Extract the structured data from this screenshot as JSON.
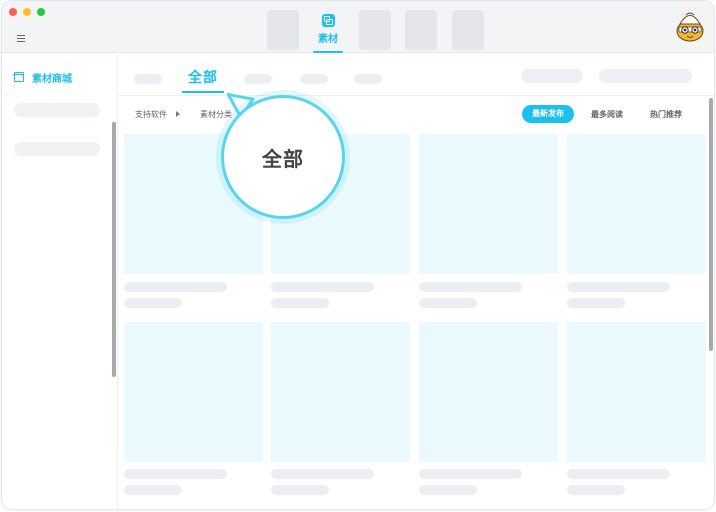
{
  "colors": {
    "accent": "#1cc0ee",
    "card_bg": "#eafaff",
    "placeholder": "#eceef1"
  },
  "titlebar": {
    "menu_icon": "hamburger-icon",
    "active_tab_label": "素材",
    "active_tab_icon": "material-icon",
    "avatar_icon": "mascot-avatar-icon"
  },
  "sidebar": {
    "active_item_label": "素材商城",
    "active_item_icon": "store-icon"
  },
  "main": {
    "active_sub_tab": "全部",
    "filters": {
      "software_label": "支持软件",
      "category_label": "素材分类"
    },
    "sort": {
      "latest": "最新发布",
      "most_read": "最多阅读",
      "hot": "热门推荐"
    }
  },
  "callout": {
    "text": "全部"
  }
}
